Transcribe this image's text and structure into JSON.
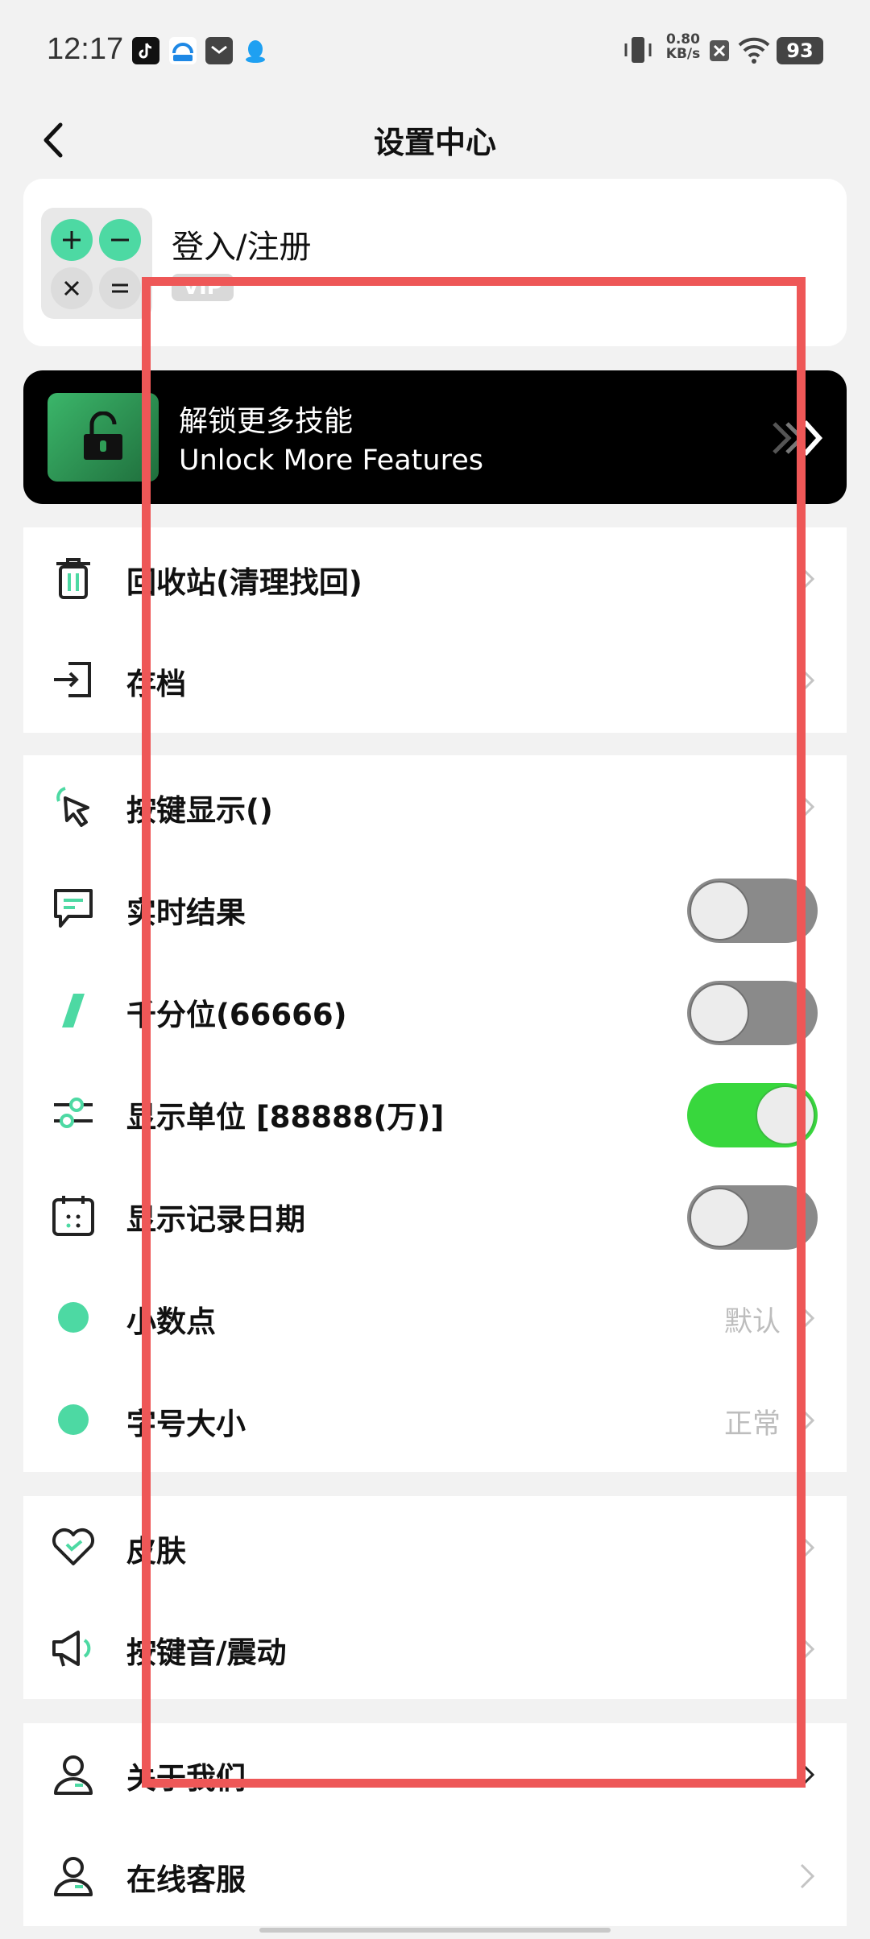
{
  "status_bar": {
    "time": "12:17",
    "network_speed": "0.80",
    "network_unit": "KB/s",
    "battery": "93"
  },
  "nav": {
    "title": "设置中心"
  },
  "account": {
    "login_label": "登入/注册",
    "vip_label": "VIP"
  },
  "unlock": {
    "title": "解锁更多技能",
    "subtitle": "Unlock More Features"
  },
  "groups": {
    "data": [
      {
        "label": "回收站(清理找回)",
        "icon": "trash-icon"
      },
      {
        "label": "存档",
        "icon": "archive-login-icon"
      }
    ],
    "display": [
      {
        "label": "按键显示()",
        "icon": "cursor-click-icon",
        "type": "chevron"
      },
      {
        "label": "实时结果",
        "icon": "message-square-icon",
        "type": "toggle",
        "on": false
      },
      {
        "label": "千分位(66666)",
        "icon": "slash-icon",
        "type": "toggle",
        "on": false
      },
      {
        "label": "显示单位 [88888(万)]",
        "icon": "sliders-icon",
        "type": "toggle",
        "on": true
      },
      {
        "label": "显示记录日期",
        "icon": "calendar-icon",
        "type": "toggle",
        "on": false
      },
      {
        "label": "小数点",
        "icon": "dot-icon",
        "type": "value",
        "value": "默认"
      },
      {
        "label": "字号大小",
        "icon": "dot-icon",
        "type": "value",
        "value": "正常"
      }
    ],
    "style": [
      {
        "label": "皮肤",
        "icon": "heart-icon"
      },
      {
        "label": "按键音/震动",
        "icon": "megaphone-icon"
      }
    ],
    "about": [
      {
        "label": "关于我们",
        "icon": "user-icon"
      },
      {
        "label": "在线客服",
        "icon": "user-icon"
      }
    ]
  },
  "colors": {
    "accent": "#4dd9a3",
    "toggle_on": "#38d73d",
    "toggle_off": "#8a8a8a",
    "highlight_box": "#ee5757"
  }
}
